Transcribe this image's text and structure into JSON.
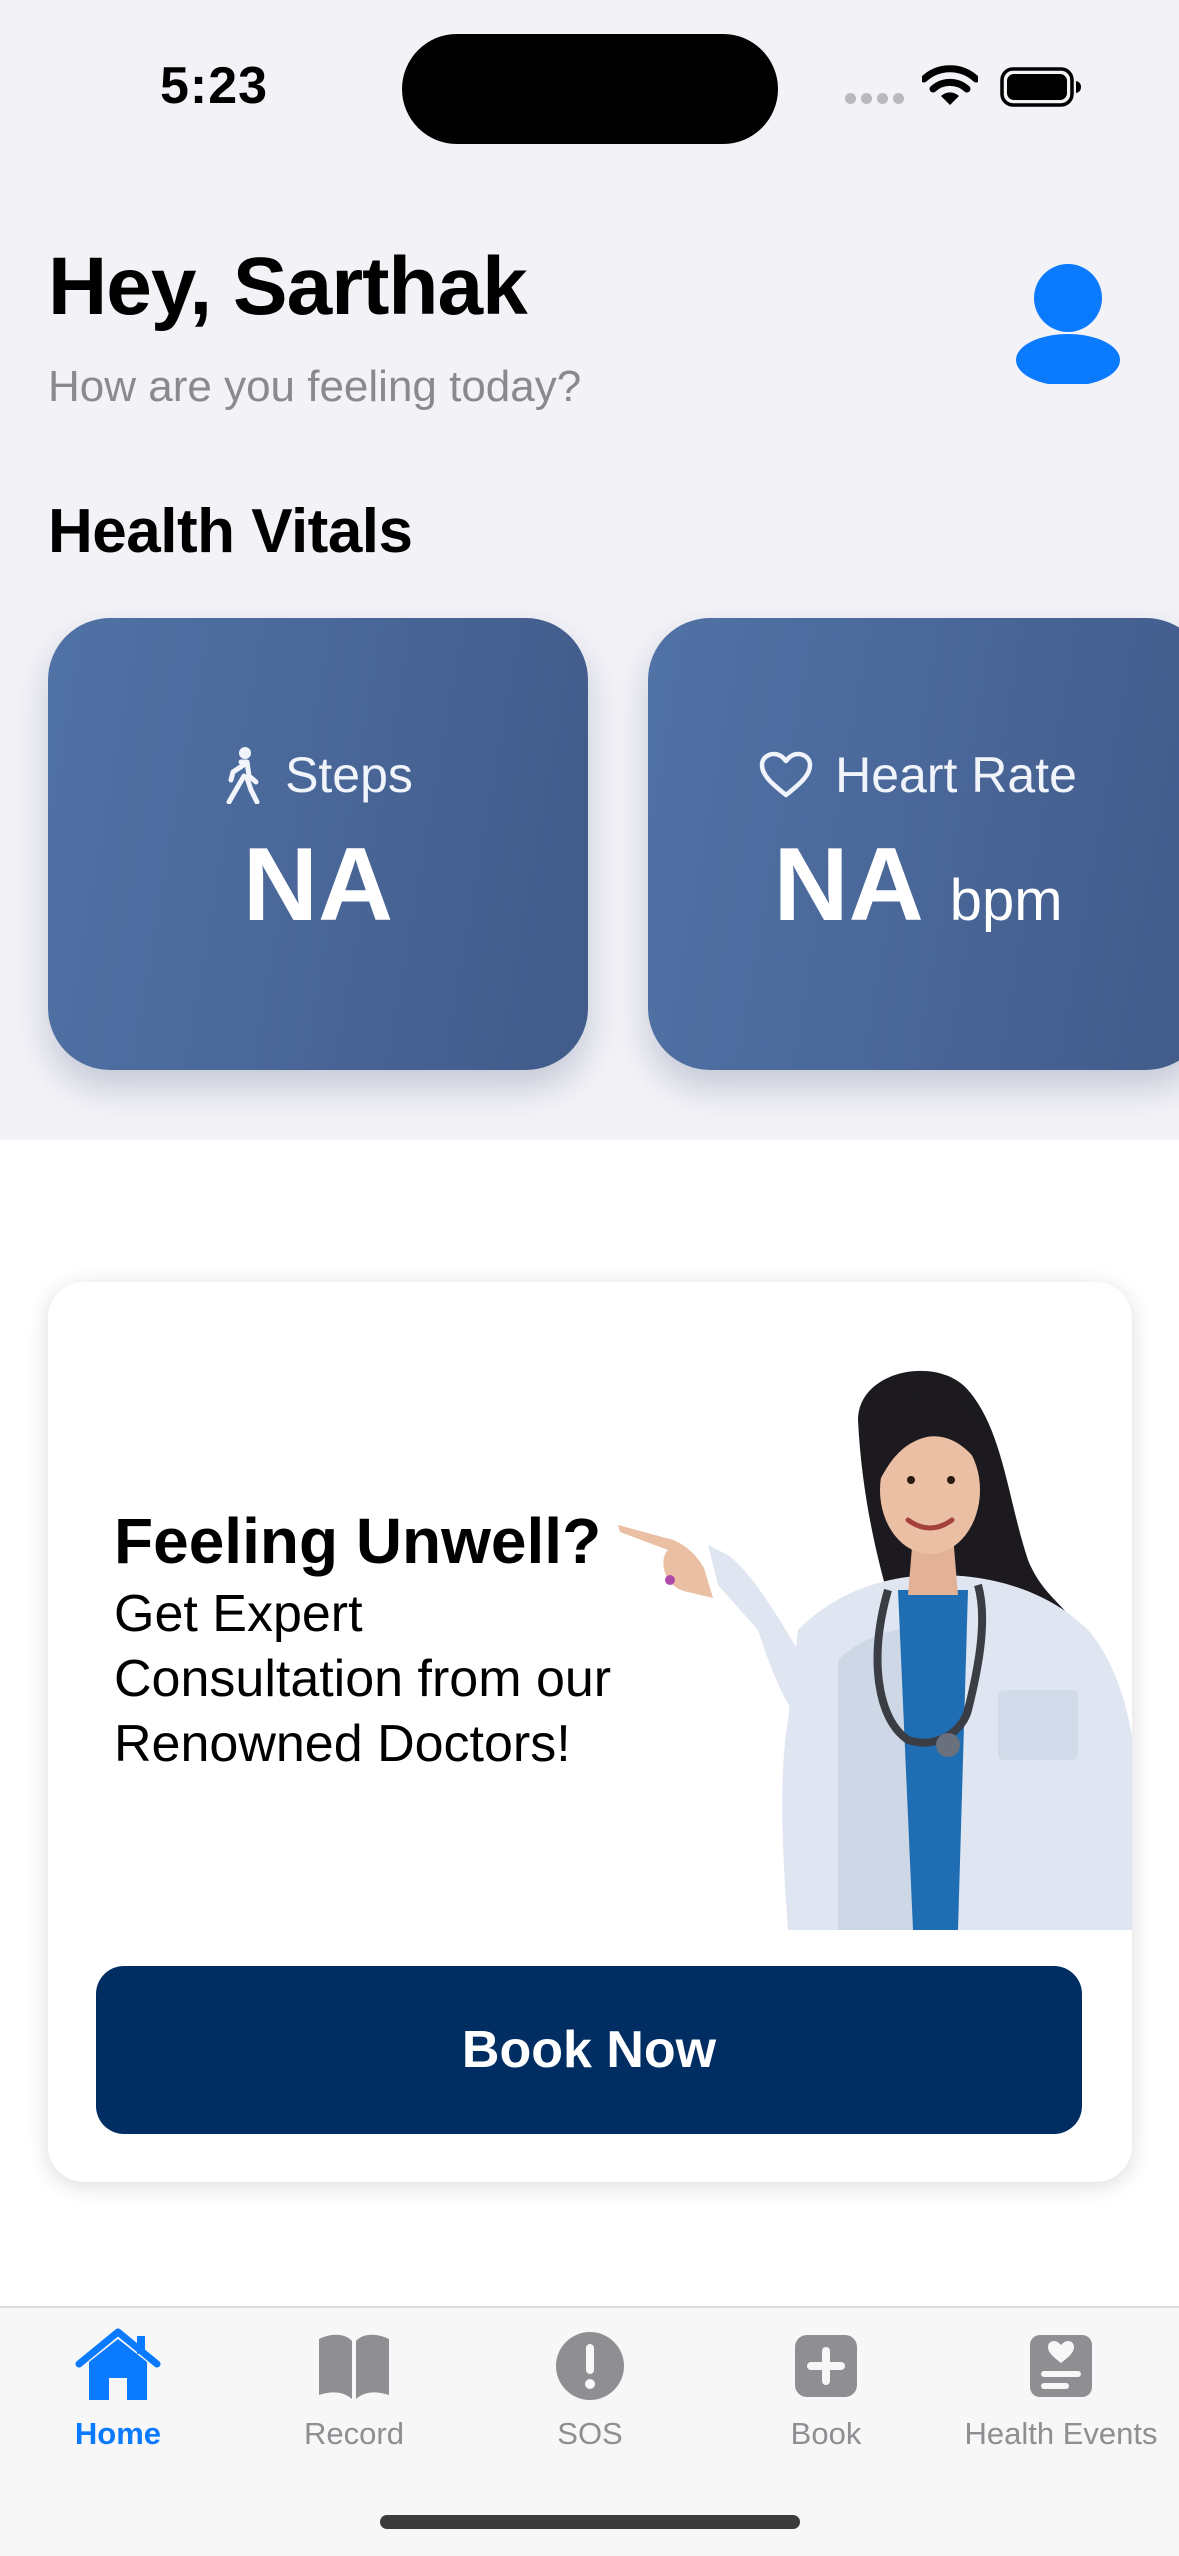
{
  "status_bar": {
    "time": "5:23"
  },
  "header": {
    "greeting": "Hey, Sarthak",
    "subtitle": "How are you feeling today?",
    "profile_icon": "person-circle-icon"
  },
  "vitals": {
    "title": "Health Vitals",
    "cards": [
      {
        "label": "Steps",
        "value": "NA",
        "unit": "",
        "icon": "walking-figure-icon"
      },
      {
        "label": "Heart Rate",
        "value": "NA",
        "unit": "bpm",
        "icon": "heart-outline-icon"
      }
    ]
  },
  "promo": {
    "title": "Feeling Unwell?",
    "body_lines": [
      "Get Expert",
      "Consultation from our",
      "Renowned Doctors!"
    ],
    "button_label": "Book Now",
    "image": "doctor-pointing-illustration"
  },
  "tab_bar": {
    "active": "Home",
    "tabs": [
      {
        "label": "Home",
        "icon": "house-fill-icon"
      },
      {
        "label": "Record",
        "icon": "book-fill-icon"
      },
      {
        "label": "SOS",
        "icon": "exclamation-circle-icon"
      },
      {
        "label": "Book",
        "icon": "plus-square-icon"
      },
      {
        "label": "Health Events",
        "icon": "list-heart-icon"
      }
    ]
  },
  "colors": {
    "accent": "#0a7aff",
    "card_gradient_start": "#5172a6",
    "card_gradient_end": "#415b8a",
    "button": "#002d62",
    "background": "#f2f2f7"
  }
}
